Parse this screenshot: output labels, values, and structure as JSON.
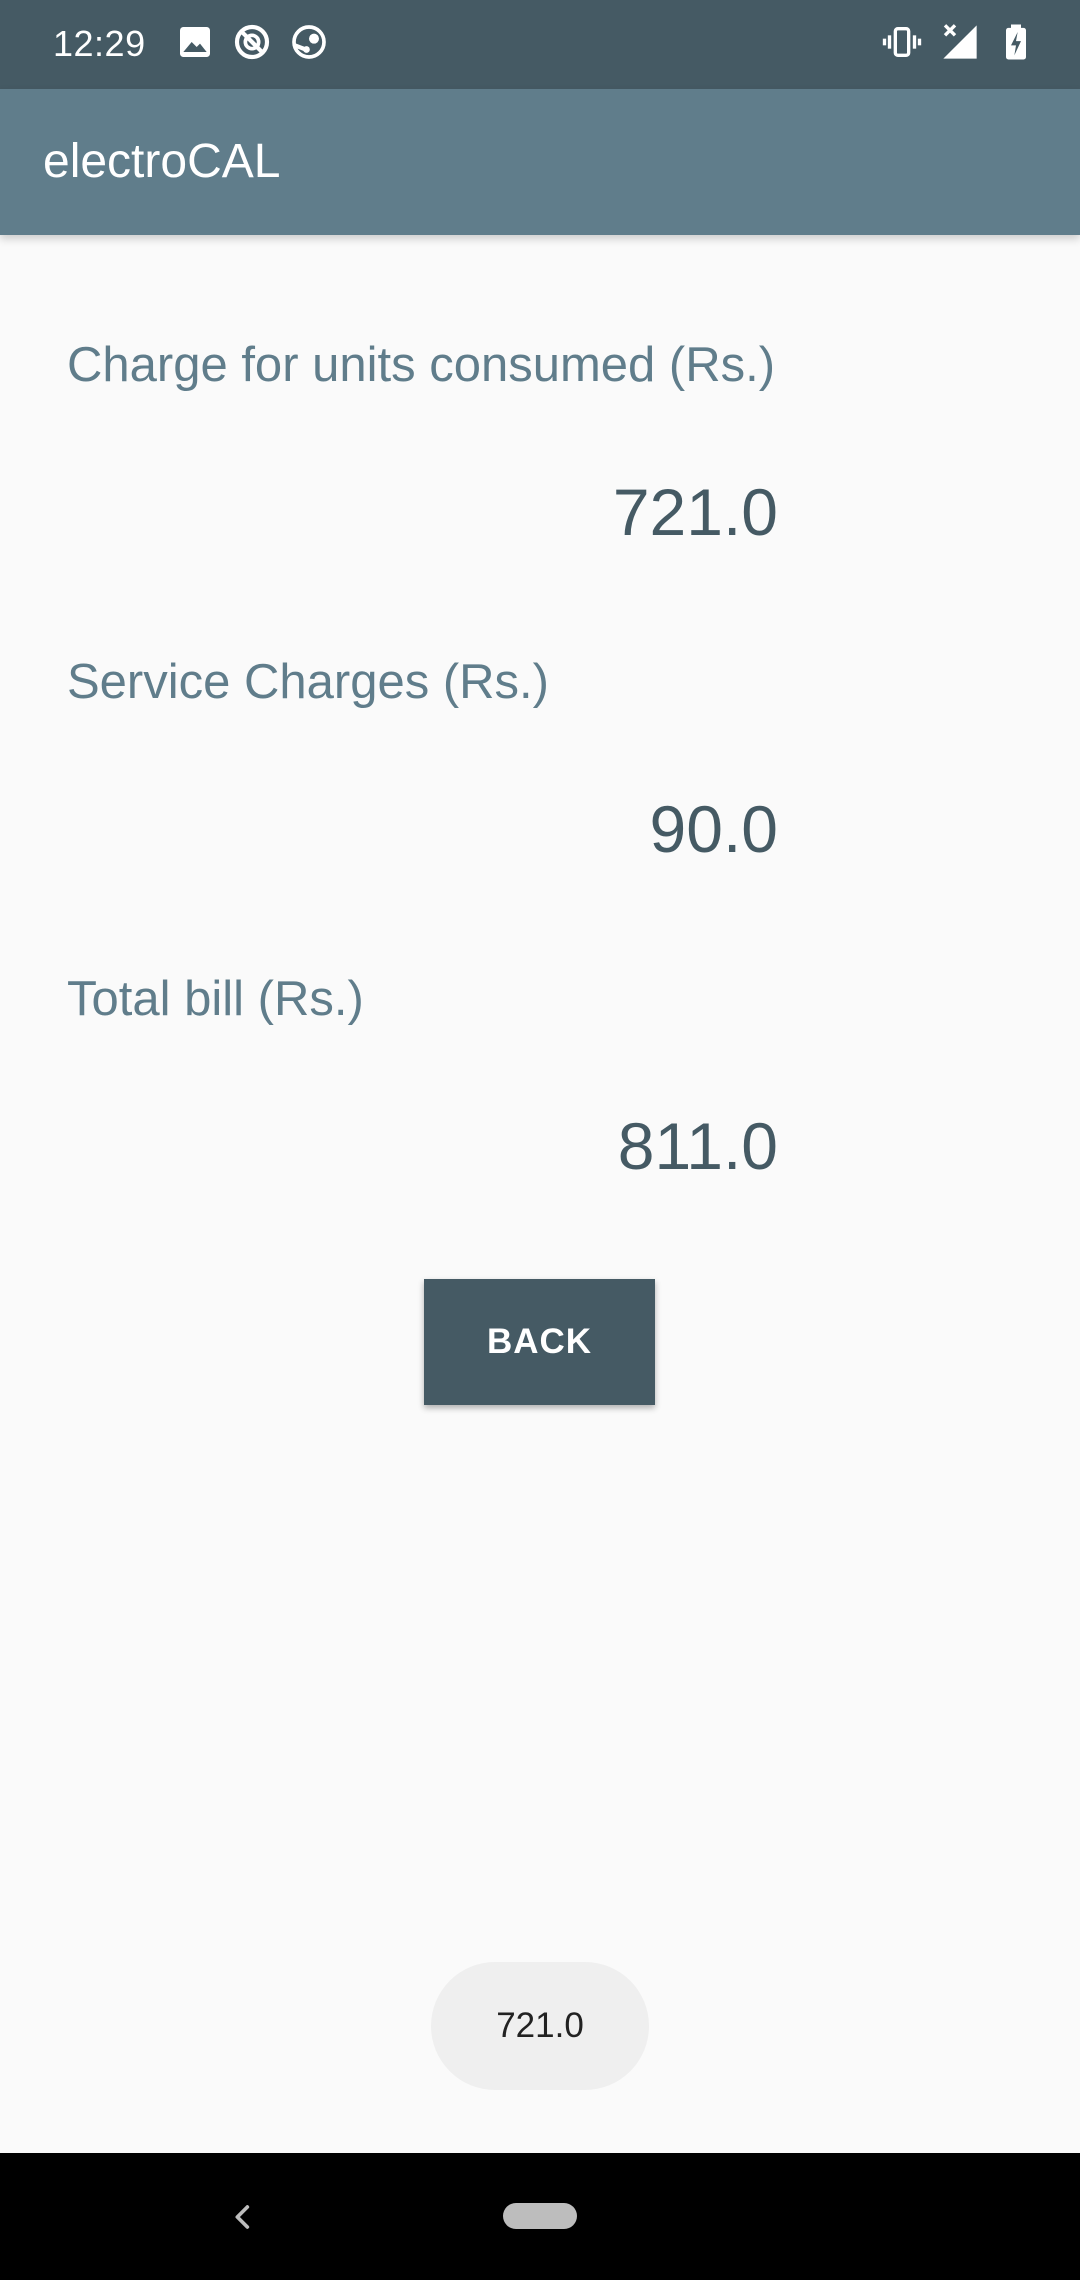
{
  "status_bar": {
    "time": "12:29",
    "left_icons": [
      "image-icon",
      "do-not-disturb-icon",
      "steam-icon"
    ],
    "right_icons": [
      "vibrate-icon",
      "no-signal-icon",
      "battery-charging-icon"
    ]
  },
  "app_bar": {
    "title": "electroCAL"
  },
  "main": {
    "units_charge": {
      "label": "Charge for units consumed (Rs.)",
      "value": "721.0"
    },
    "service_charge": {
      "label": "Service Charges (Rs.)",
      "value": "90.0"
    },
    "total_bill": {
      "label": "Total bill (Rs.)",
      "value": "811.0"
    },
    "back_button_label": "BACK"
  },
  "toast": {
    "message": "721.0"
  },
  "nav_bar": {
    "icons": [
      "back-icon",
      "home-pill-icon"
    ]
  },
  "colors": {
    "status_bar": "#455a64",
    "app_bar": "#607d8b",
    "label_text": "#607d8b",
    "value_text": "#455a64",
    "button": "#455a64",
    "background": "#fafafa"
  }
}
